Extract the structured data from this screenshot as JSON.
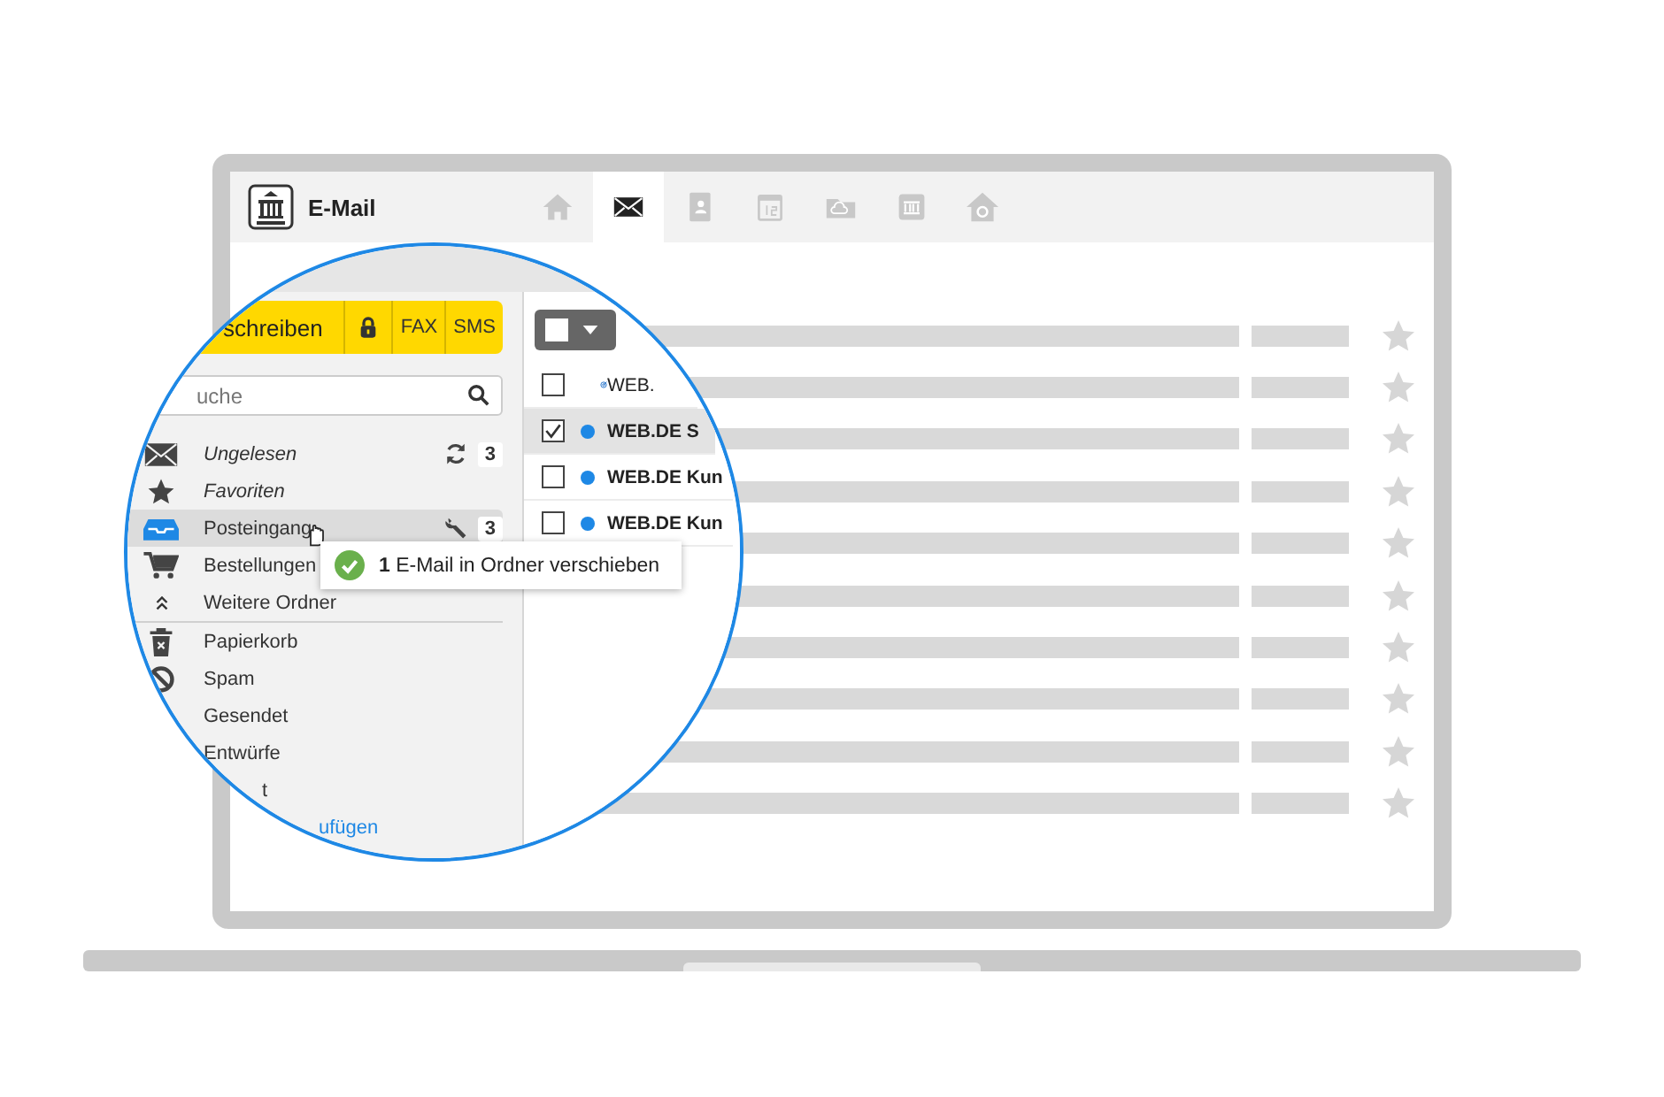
{
  "app": {
    "title": "E-Mail",
    "nav": [
      {
        "kind": "home",
        "selected": false
      },
      {
        "kind": "mail",
        "selected": true
      },
      {
        "kind": "contacts",
        "selected": false
      },
      {
        "kind": "calendar",
        "selected": false
      },
      {
        "kind": "cloud",
        "selected": false
      },
      {
        "kind": "bank",
        "selected": false
      },
      {
        "kind": "homemail",
        "selected": false
      }
    ]
  },
  "magnifier": {
    "compose": {
      "label": "schreiben",
      "fax": "FAX",
      "sms": "SMS"
    },
    "search": {
      "placeholder": "uche"
    },
    "folders": [
      {
        "kind": "smart-mail",
        "label": "Ungelesen",
        "selected": false,
        "refresh": true,
        "settings": false,
        "count": "3"
      },
      {
        "kind": "smart-star",
        "label": "Favoriten",
        "selected": false,
        "refresh": false,
        "settings": false
      },
      {
        "kind": "inbox",
        "label": "Posteingang",
        "selected": true,
        "refresh": false,
        "settings": true,
        "count": "3"
      },
      {
        "kind": "cart",
        "label": "Bestellungen",
        "selected": false,
        "refresh": false,
        "settings": false
      },
      {
        "kind": "expand",
        "label": "Weitere Ordner",
        "selected": false,
        "refresh": false,
        "settings": false
      },
      {
        "kind": "trash",
        "label": "Papierkorb",
        "selected": false,
        "refresh": false,
        "settings": false
      },
      {
        "kind": "spam",
        "label": "Spam",
        "selected": false,
        "refresh": false,
        "settings": false
      },
      {
        "kind": "plain",
        "label": "Gesendet",
        "selected": false,
        "refresh": false,
        "settings": false
      },
      {
        "kind": "plain",
        "label": "Entwürfe",
        "selected": false,
        "refresh": false,
        "settings": false
      },
      {
        "kind": "fragment",
        "label": "t",
        "selected": false,
        "refresh": false,
        "settings": false
      },
      {
        "kind": "link",
        "label": "ufügen",
        "selected": false,
        "refresh": false,
        "settings": false
      }
    ],
    "messages": [
      {
        "kind": "newsletter",
        "sender": "WEB.",
        "checked": false,
        "selected": false,
        "unread": false
      },
      {
        "kind": "mail",
        "sender": "WEB.DE S",
        "checked": true,
        "selected": true,
        "unread": true
      },
      {
        "kind": "mail",
        "sender": "WEB.DE Kun",
        "checked": false,
        "selected": false,
        "unread": true
      },
      {
        "kind": "mail",
        "sender": "WEB.DE Kun",
        "checked": false,
        "selected": false,
        "unread": true
      }
    ]
  },
  "toast": {
    "text": "**1** E-Mail in Ordner verschieben"
  }
}
